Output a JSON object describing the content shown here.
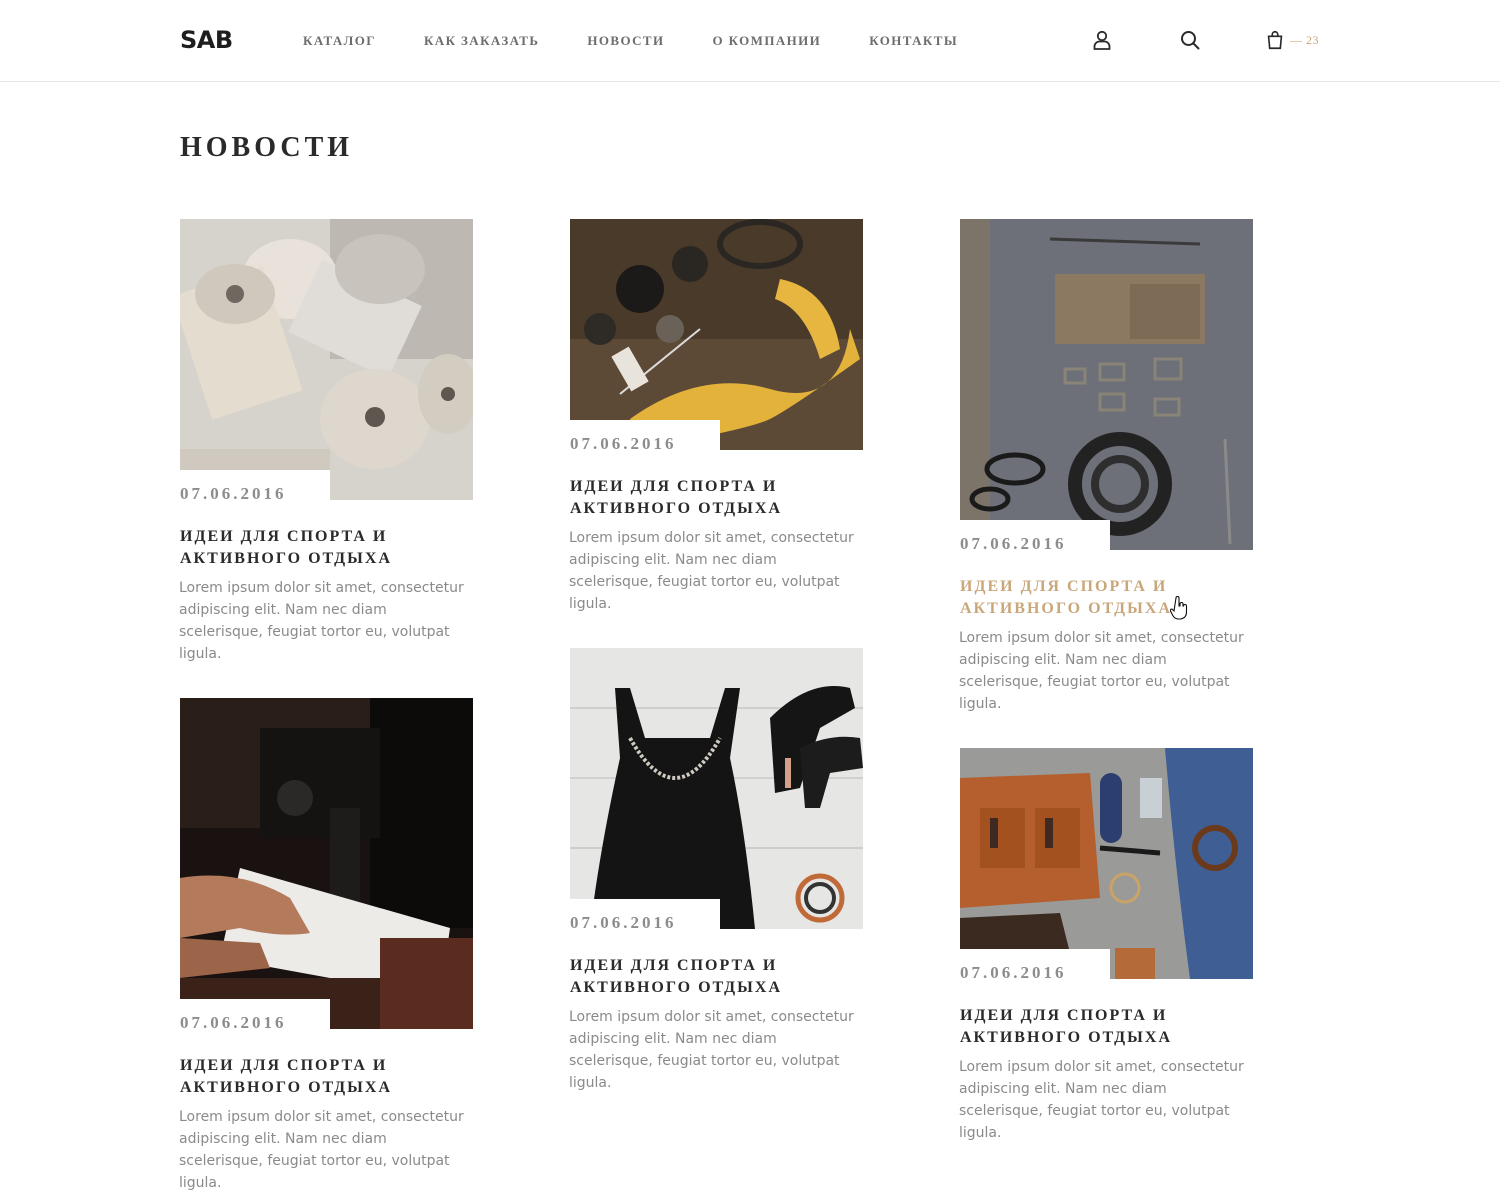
{
  "header": {
    "logo": "SAB",
    "nav": [
      "КАТАЛОГ",
      "КАК ЗАКАЗАТЬ",
      "НОВОСТИ",
      "О КОМПАНИИ",
      "КОНТАКТЫ"
    ],
    "cart_count": "— 23"
  },
  "page": {
    "title": "НОВОСТИ"
  },
  "news": [
    {
      "date": "07.06.2016",
      "title": "Идеи для спорта и активного отдыха",
      "text": "Lorem ipsum dolor sit amet, consectetur adipiscing elit. Nam nec diam scelerisque, feugiat tortor eu, volutpat ligula.",
      "image": "thread-spools"
    },
    {
      "date": "07.06.2016",
      "title": "Идеи для спорта и активного отдыха",
      "text": "Lorem ipsum dolor sit amet, consectetur adipiscing elit. Nam nec diam scelerisque, feugiat tortor eu, volutpat ligula.",
      "image": "tailor-tools"
    },
    {
      "date": "07.06.2016",
      "title": "Идеи для спорта и активного отдыха",
      "text": "Lorem ipsum dolor sit amet, consectetur adipiscing elit. Nam nec diam scelerisque, feugiat tortor eu, volutpat ligula.",
      "image": "leather-tools"
    },
    {
      "date": "07.06.2016",
      "title": "Идеи для спорта и активного отдыха",
      "text": "Lorem ipsum dolor sit amet, consectetur adipiscing elit. Nam nec diam scelerisque, feugiat tortor eu, volutpat ligula.",
      "image": "sewing-machine"
    },
    {
      "date": "07.06.2016",
      "title": "Идеи для спорта и активного отдыха",
      "text": "Lorem ipsum dolor sit amet, consectetur adipiscing elit. Nam nec diam scelerisque, feugiat tortor eu, volutpat ligula.",
      "image": "dress-and-heels"
    },
    {
      "date": "07.06.2016",
      "title": "Идеи для спорта и активного отдыха",
      "text": "Lorem ipsum dolor sit amet, consectetur adipiscing elit. Nam nec diam scelerisque, feugiat tortor eu, volutpat ligula.",
      "image": "bag-and-jeans"
    }
  ],
  "colors": {
    "accent": "#c9a77a",
    "text": "#2a2a2a",
    "muted": "#8a8a8a"
  }
}
